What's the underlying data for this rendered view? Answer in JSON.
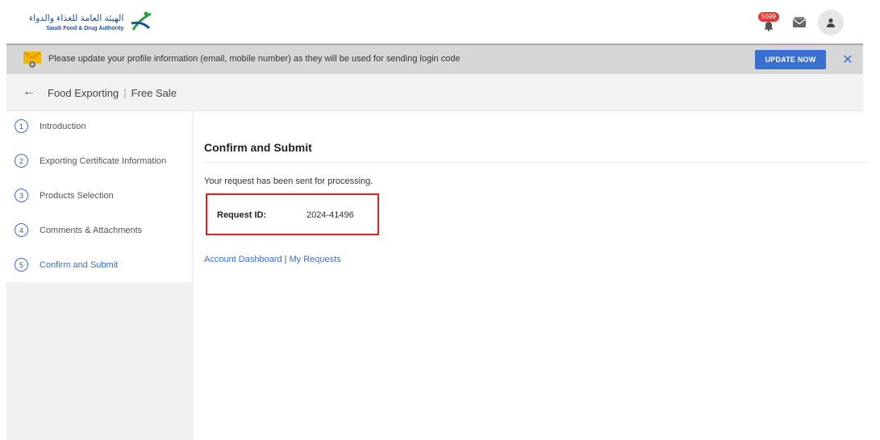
{
  "header": {
    "logo_ar": "الهيئة العامة للغذاء والدواء",
    "logo_en": "Saudi Food & Drug Authority",
    "notification_count": "5699",
    "icons": {
      "notifications": "bell-icon",
      "messages": "mail-icon",
      "profile": "user-icon"
    }
  },
  "banner": {
    "message": "Please update your profile information (email, mobile number) as they will be used for sending login code",
    "update_label": "UPDATE NOW",
    "close_label": "✕"
  },
  "breadcrumb": {
    "back": "←",
    "section": "Food Exporting",
    "page": "Free Sale",
    "separator": "|"
  },
  "steps": [
    {
      "num": "1",
      "label": "Introduction"
    },
    {
      "num": "2",
      "label": "Exporting Certificate Information"
    },
    {
      "num": "3",
      "label": "Products Selection"
    },
    {
      "num": "4",
      "label": "Comments & Attachments"
    },
    {
      "num": "5",
      "label": "Confirm and Submit"
    }
  ],
  "main": {
    "title": "Confirm and Submit",
    "message": "Your request has been sent for processing.",
    "request_label": "Request ID:",
    "request_id": "2024-41496",
    "link_dashboard": "Account Dashboard",
    "link_sep": "|",
    "link_requests": "My Requests"
  },
  "colors": {
    "accent": "#3a6fd1",
    "highlight": "#e02020",
    "badge": "#e53935"
  }
}
